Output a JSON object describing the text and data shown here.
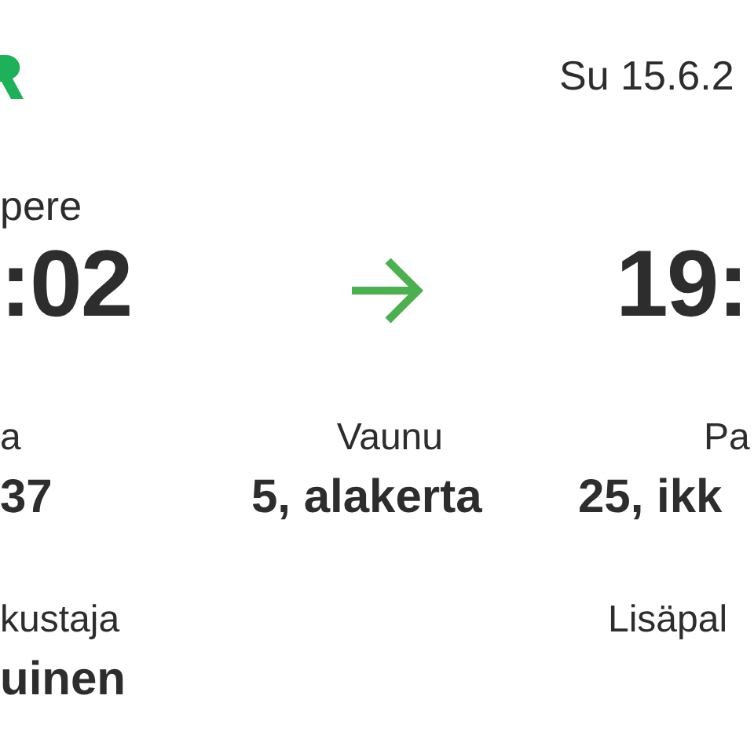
{
  "header": {
    "date": "Su 15.6.2"
  },
  "route": {
    "from_station": "pere",
    "departure_time": ":02",
    "arrival_time": "19:"
  },
  "details": [
    {
      "label": "a",
      "value": "37"
    },
    {
      "label": "Vaunu",
      "value": "5, alakerta"
    },
    {
      "label": "Pa",
      "value": "25, ikk"
    }
  ],
  "extra": [
    {
      "label": "kustaja",
      "value": "uinen"
    },
    {
      "label": "Lisäpal"
    }
  ]
}
